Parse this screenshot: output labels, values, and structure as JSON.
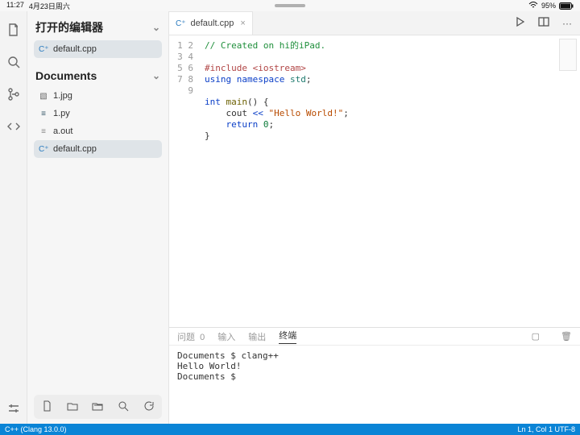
{
  "status_bar": {
    "time": "11:27",
    "date": "4月23日周六",
    "battery_percent": "95%",
    "wifi": true
  },
  "sidebar": {
    "open_editors_label": "打开的编辑器",
    "open_editors": [
      {
        "icon": "cpp",
        "name": "default.cpp",
        "active": true
      }
    ],
    "documents_label": "Documents",
    "files": [
      {
        "icon": "img",
        "name": "1.jpg"
      },
      {
        "icon": "py",
        "name": "1.py"
      },
      {
        "icon": "bin",
        "name": "a.out"
      },
      {
        "icon": "cpp",
        "name": "default.cpp",
        "active": true
      }
    ]
  },
  "tab": {
    "name": "default.cpp"
  },
  "code": {
    "lines": [
      "1",
      "2",
      "3",
      "4",
      "5",
      "6",
      "7",
      "8",
      "9"
    ],
    "l1_comment": "// Created on hi的iPad.",
    "l3_include_kw": "#include",
    "l3_include_arg": "<iostream>",
    "l4_using": "using",
    "l4_namespace": "namespace",
    "l4_std": "std",
    "l6_int": "int",
    "l6_main": "main",
    "l6_rest": "() {",
    "l7_cout": "cout",
    "l7_op": "<<",
    "l7_str": "\"Hello World!\"",
    "l8_return": "return",
    "l8_zero": "0",
    "l9_brace": "}"
  },
  "panel": {
    "tabs": {
      "problems": "问题",
      "problems_count": "0",
      "output": "输入",
      "debug": "输出",
      "terminal": "终端"
    },
    "terminal_lines": [
      "Documents $ clang++",
      "Hello World!",
      "Documents $"
    ]
  },
  "footer": {
    "left": "C++ (Clang 13.0.0)",
    "right": "Ln 1, Col 1  UTF-8"
  }
}
